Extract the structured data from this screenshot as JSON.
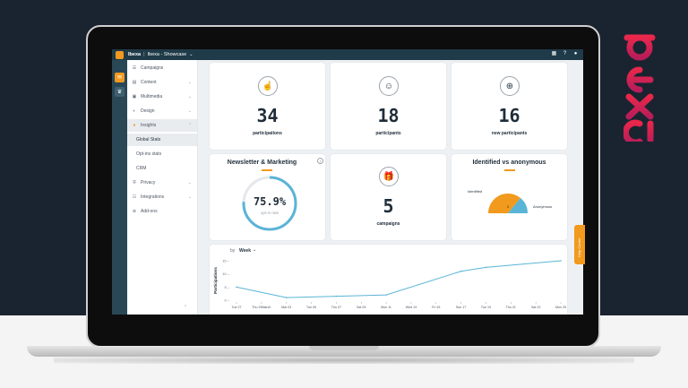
{
  "app": {
    "name": "Ibexa",
    "separator": "|",
    "workspace": "Ibexa - Showcase"
  },
  "sidebar": {
    "items": [
      {
        "label": "Campaigns",
        "icon": "list-icon"
      },
      {
        "label": "Content",
        "icon": "content-icon"
      },
      {
        "label": "Multimedia",
        "icon": "image-icon"
      },
      {
        "label": "Design",
        "icon": "palette-icon"
      },
      {
        "label": "Insights",
        "icon": "insights-icon"
      },
      {
        "label": "Global Stats"
      },
      {
        "label": "Opt-ins stats"
      },
      {
        "label": "CRM"
      },
      {
        "label": "Privacy",
        "icon": "shield-icon"
      },
      {
        "label": "Integrations",
        "icon": "integrations-icon"
      },
      {
        "label": "Add-ons",
        "icon": "plus-circle-icon"
      }
    ]
  },
  "stats": {
    "participations": {
      "value": "34",
      "label": "participations"
    },
    "participants": {
      "value": "18",
      "label": "participants"
    },
    "new_participants": {
      "value": "16",
      "label": "new participants"
    },
    "campaigns": {
      "value": "5",
      "label": "campaigns"
    }
  },
  "newsletter": {
    "title": "Newsletter & Marketing",
    "rate": "75.9%",
    "rate_fraction": 0.759,
    "rate_label": "opt-in rate",
    "info": "i"
  },
  "identified": {
    "title": "Identified vs anonymous",
    "label_identified": "Identified",
    "label_anonymous": "Anonymous",
    "slice_label": "2",
    "identified_share": 0.72,
    "colors": {
      "identified": "#f29a1e",
      "anonymous": "#5ab4d6"
    }
  },
  "timeline": {
    "by_label": "by",
    "period": "Week",
    "help_tab": "Help Center"
  },
  "chart_data": {
    "type": "line",
    "ylabel": "Participations",
    "ylim": [
      0,
      15
    ],
    "yticks": [
      "15",
      "10",
      "5",
      "0"
    ],
    "x": [
      "Tue 27",
      "Thu 29March",
      "Mar 03",
      "Tue 05",
      "Thu 07",
      "Sat 09",
      "Mon 11",
      "Wed 13",
      "Fri 15",
      "Sun 17",
      "Tue 19",
      "Thu 21",
      "Sat 23",
      "Mon 25"
    ],
    "series": [
      {
        "values": [
          5,
          null,
          1,
          null,
          1.5,
          null,
          2,
          null,
          null,
          11,
          12.5,
          null,
          null,
          15
        ]
      }
    ],
    "color": "#5ab4d6"
  },
  "brand_text": "ibexa",
  "colors": {
    "accent": "#f29a1e",
    "navy": "#1f3a48",
    "brand": "#e8274b"
  }
}
